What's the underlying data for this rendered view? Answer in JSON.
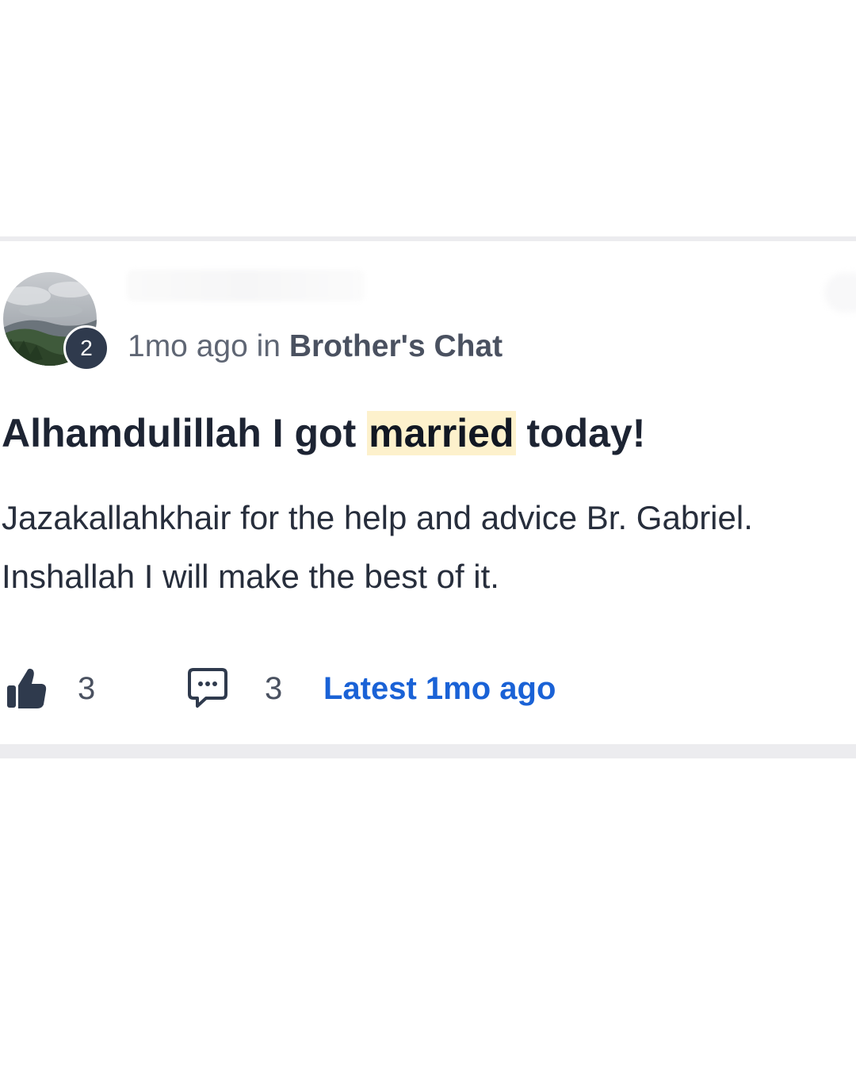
{
  "post": {
    "author_level": "2",
    "meta": {
      "time": "1mo ago",
      "in_word": "in",
      "space": "Brother's Chat"
    },
    "title": {
      "before": "Alhamdulillah I got ",
      "highlight": "married",
      "after": " today!"
    },
    "body": {
      "line1": "Jazakallahkhair for the help and advice Br. Gabriel.",
      "line2": "Inshallah I will make the best of it."
    },
    "footer": {
      "like_count": "3",
      "comment_count": "3",
      "latest_label": "Latest 1mo ago"
    },
    "icons": {
      "like": "thumbs-up-icon",
      "comment": "speech-bubble-icon"
    },
    "colors": {
      "link": "#1a62d6",
      "highlight": "#fdf1cc",
      "badge": "#2f3a4d"
    }
  }
}
